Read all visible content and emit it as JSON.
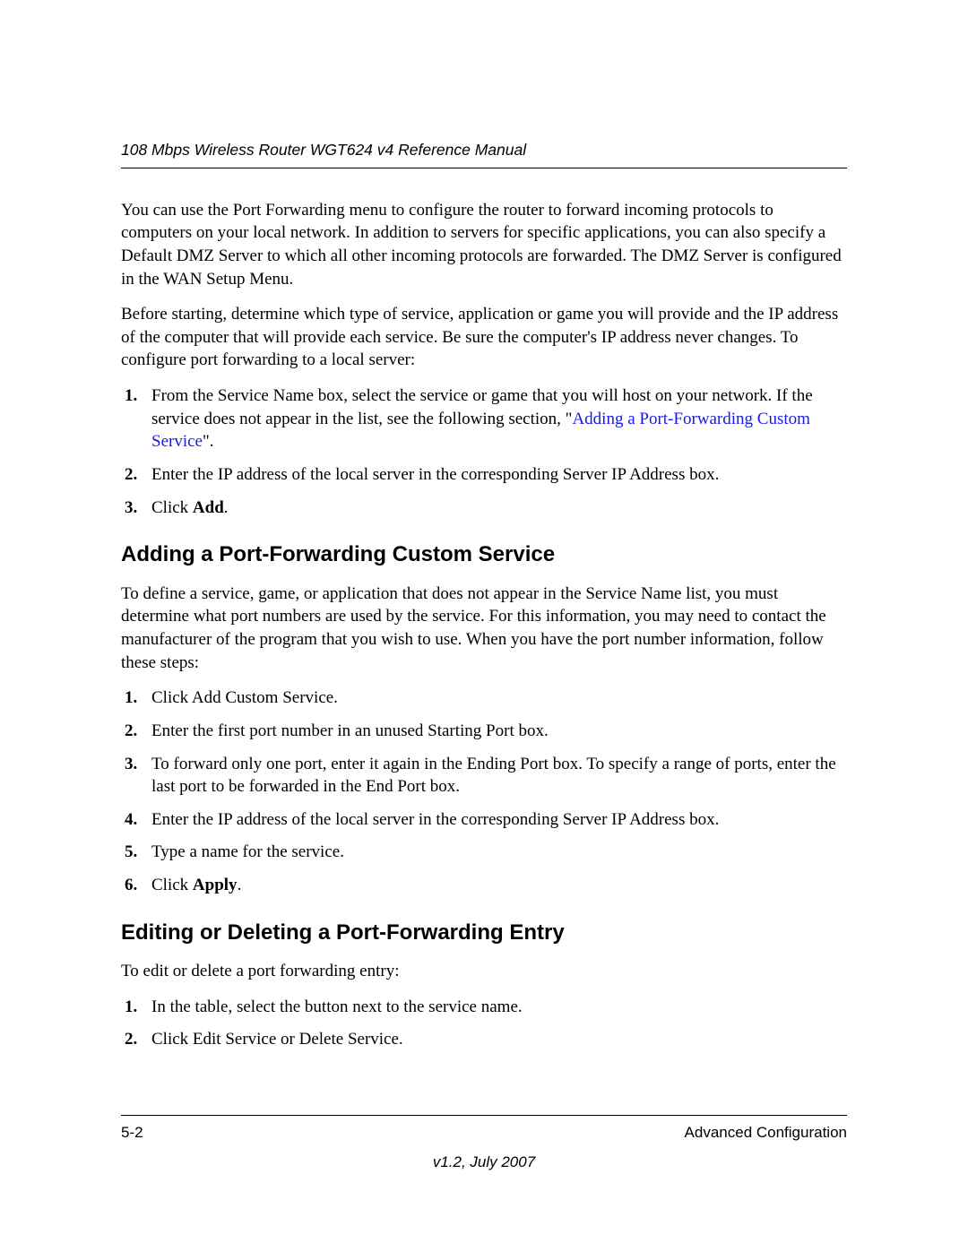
{
  "header": {
    "running_title": "108 Mbps Wireless Router WGT624 v4 Reference Manual"
  },
  "intro": {
    "p1": "You can use the Port Forwarding menu to configure the router to forward incoming protocols to computers on your local network. In addition to servers for specific applications, you can also specify a Default DMZ Server to which all other incoming protocols are forwarded. The DMZ Server is configured in the WAN Setup Menu.",
    "p2": "Before starting, determine which type of service, application or game you will provide and the IP address of the computer that will provide each service. Be sure the computer's IP address never changes. To configure port forwarding to a local server:"
  },
  "list1": {
    "i1a": "From the Service Name box, select the service or game that you will host on your network. If the service does not appear in the list, see the following section, \"",
    "i1link": "Adding a Port-Forwarding Custom Service",
    "i1b": "\".",
    "i2": "Enter the IP address of the local server in the corresponding Server IP Address box.",
    "i3a": "Click ",
    "i3b": "Add",
    "i3c": "."
  },
  "sec1": {
    "title": "Adding a Port-Forwarding Custom Service",
    "p": "To define a service, game, or application that does not appear in the Service Name list, you must determine what port numbers are used by the service. For this information, you may need to contact the manufacturer of the program that you wish to use. When you have the port number information, follow these steps:"
  },
  "list2": {
    "i1": "Click Add Custom Service.",
    "i2": "Enter the first port number in an unused Starting Port box.",
    "i3": "To forward only one port, enter it again in the Ending Port box. To specify a range of ports, enter the last port to be forwarded in the End Port box.",
    "i4": "Enter the IP address of the local server in the corresponding Server IP Address box.",
    "i5": "Type a name for the service.",
    "i6a": "Click ",
    "i6b": "Apply",
    "i6c": "."
  },
  "sec2": {
    "title": "Editing or Deleting a Port-Forwarding Entry",
    "p": "To edit or delete a port forwarding entry:"
  },
  "list3": {
    "i1": "In the table, select the button next to the service name.",
    "i2": "Click Edit Service or Delete Service."
  },
  "footer": {
    "page": "5-2",
    "section": "Advanced Configuration",
    "version": "v1.2, July 2007"
  }
}
